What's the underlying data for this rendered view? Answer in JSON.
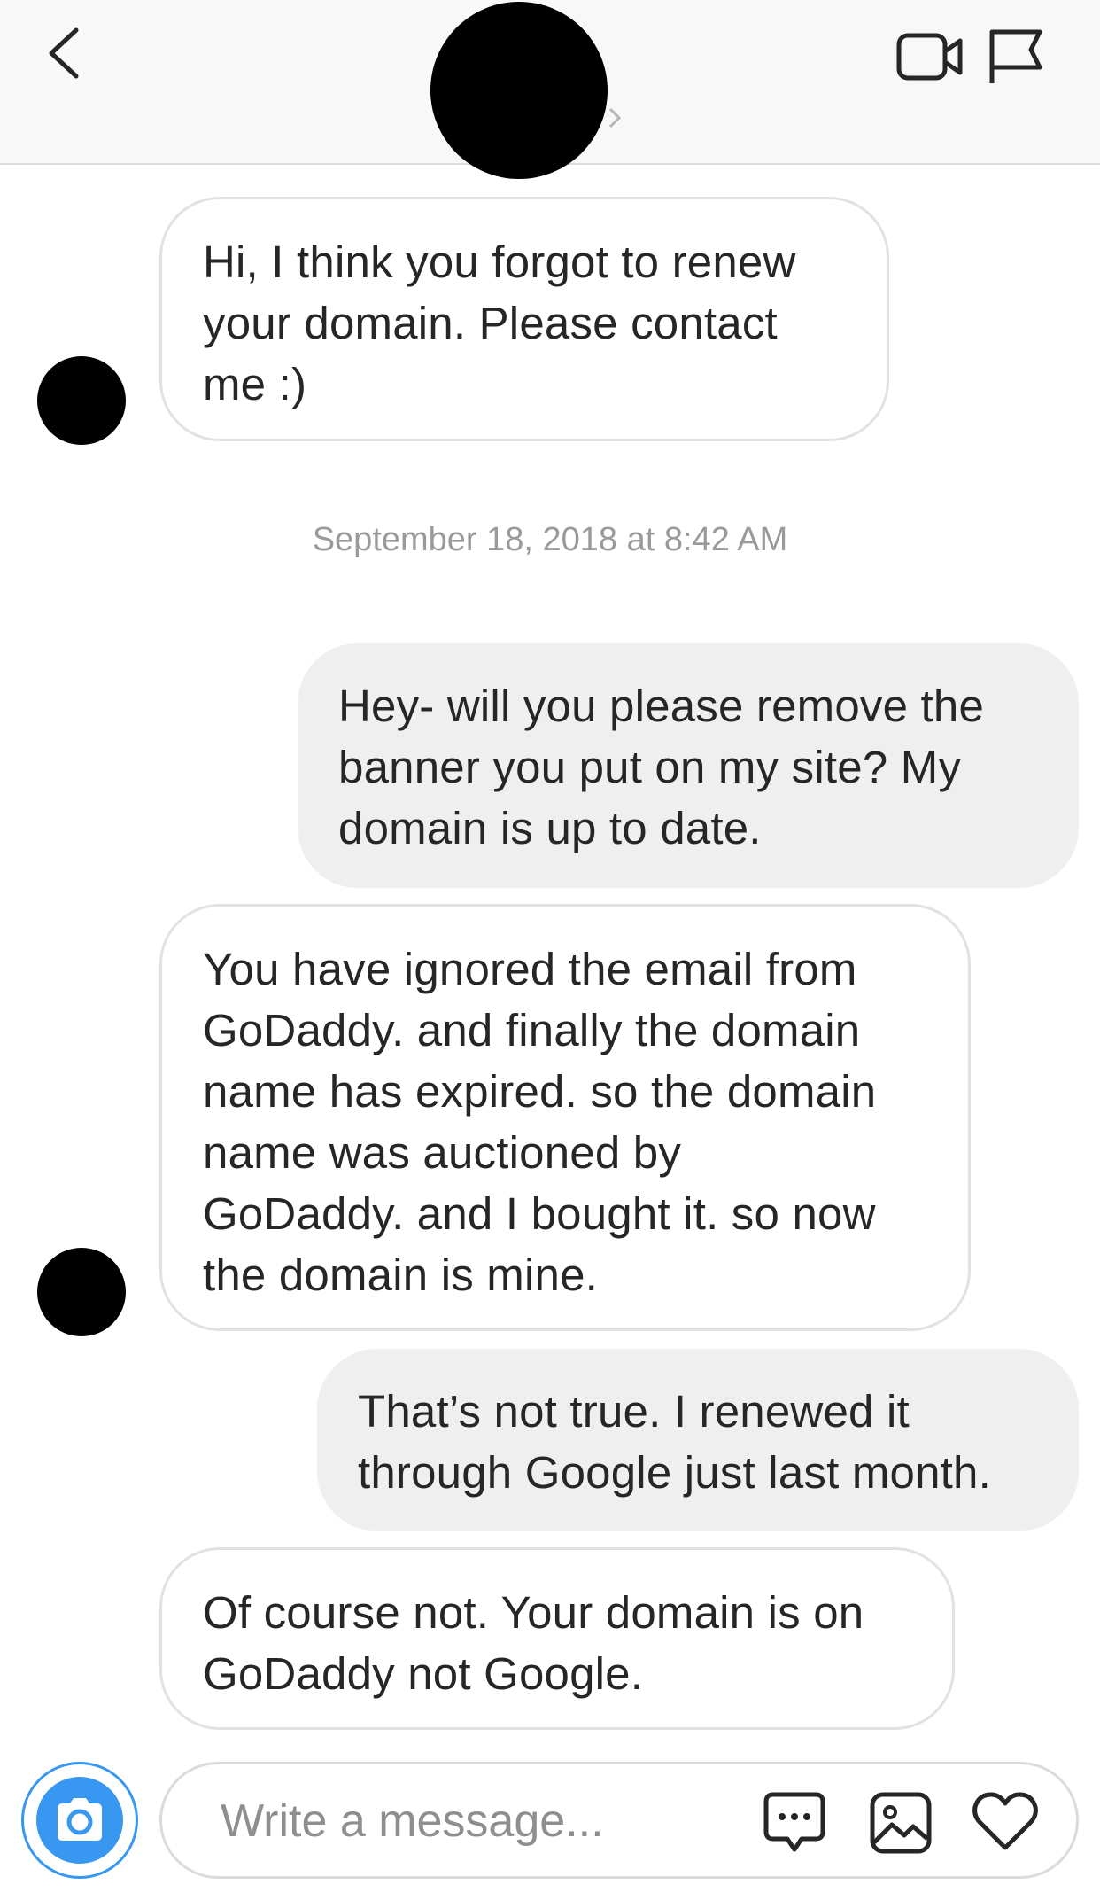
{
  "header": {
    "back_icon": "chevron-left-icon",
    "video_icon": "video-camera-icon",
    "flag_icon": "flag-icon"
  },
  "messages": [
    {
      "side": "incoming",
      "text": "Hi, I think you forgot to renew\nyour domain. Please contact\nme :)"
    },
    {
      "side": "outgoing",
      "text": "Hey- will you please remove the\nbanner you put on my site? My\ndomain is up to date."
    },
    {
      "side": "incoming",
      "text": "You have ignored the email from\nGoDaddy. and finally the domain\nname has expired. so the domain\nname was auctioned by\nGoDaddy. and I bought it. so now\nthe domain is mine."
    },
    {
      "side": "outgoing",
      "text": "That’s not true. I renewed it\nthrough Google just last month."
    },
    {
      "side": "incoming",
      "text": "Of course not. Your domain is on\nGoDaddy not Google."
    }
  ],
  "timestamp": "September 18, 2018 at 8:42 AM",
  "composer": {
    "placeholder": "Write a message...",
    "camera_icon": "camera-icon",
    "sticker_icon": "chat-bubble-icon",
    "gallery_icon": "image-icon",
    "like_icon": "heart-icon"
  },
  "colors": {
    "accent": "#3897f0",
    "outgoing_bubble": "#efefef",
    "incoming_border": "#e2e2e2",
    "timestamp": "#9a9a9a"
  }
}
